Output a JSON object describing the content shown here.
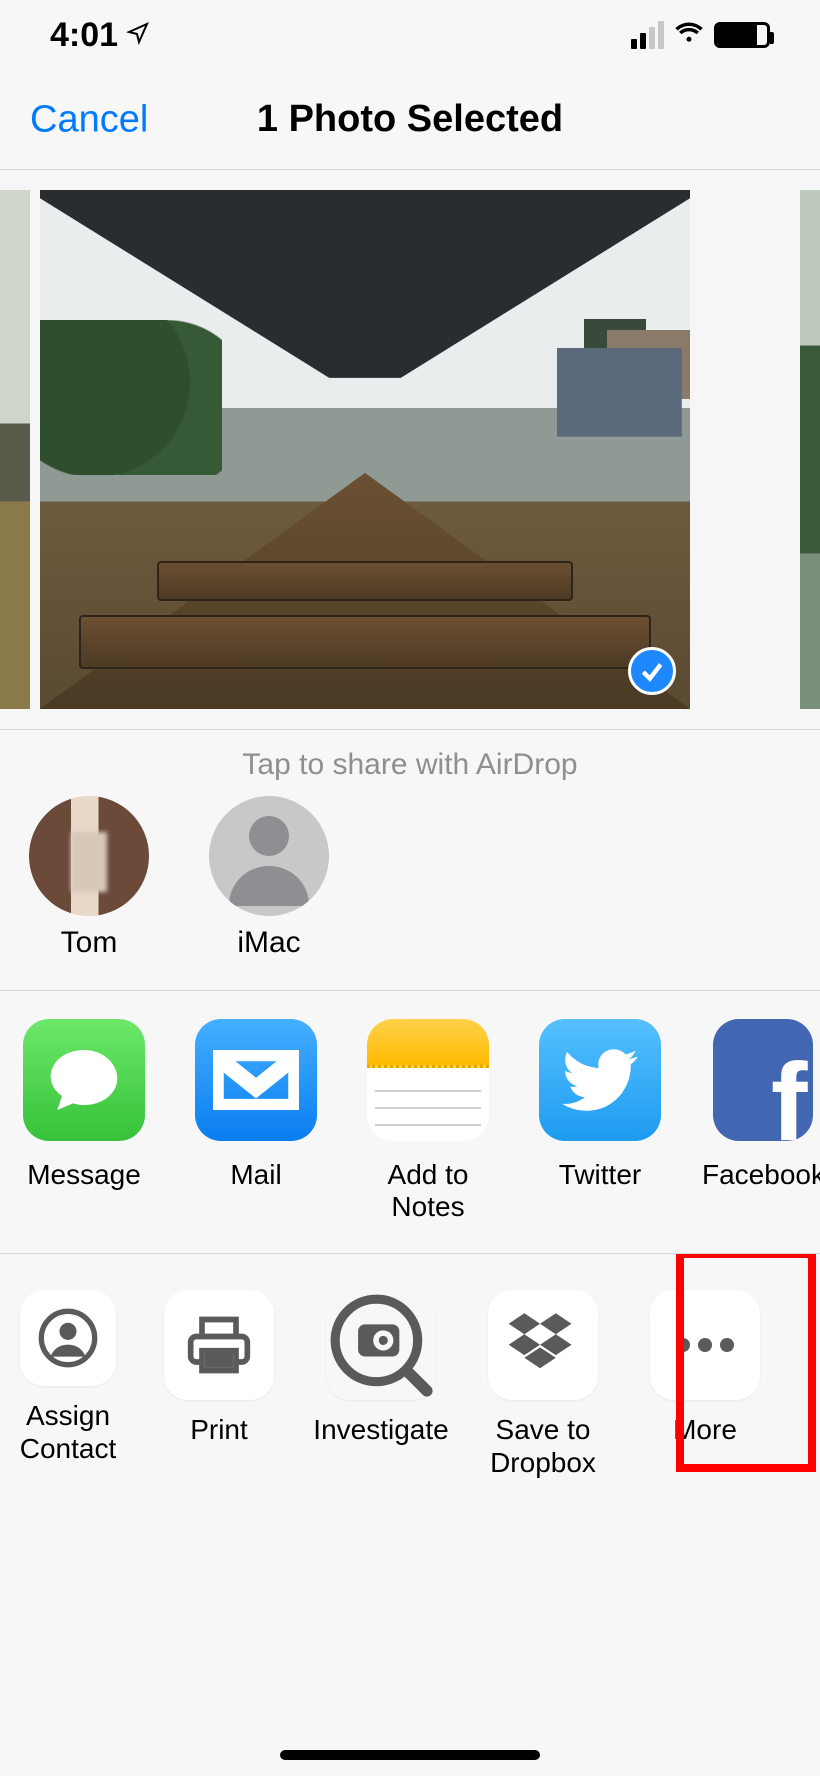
{
  "status": {
    "time": "4:01"
  },
  "nav": {
    "cancel": "Cancel",
    "title": "1 Photo Selected"
  },
  "photo": {
    "selected": true
  },
  "airdrop": {
    "prompt": "Tap to share with AirDrop",
    "targets": [
      {
        "name": "Tom"
      },
      {
        "name": "iMac"
      }
    ]
  },
  "apps": [
    {
      "label": "Message"
    },
    {
      "label": "Mail"
    },
    {
      "label": "Add to Notes"
    },
    {
      "label": "Twitter"
    },
    {
      "label": "Facebook"
    }
  ],
  "actions": [
    {
      "label": "Assign Contact"
    },
    {
      "label": "Print"
    },
    {
      "label": "Investigate"
    },
    {
      "label": "Save to Dropbox"
    },
    {
      "label": "More"
    }
  ],
  "highlight": {
    "target": "more-action"
  }
}
